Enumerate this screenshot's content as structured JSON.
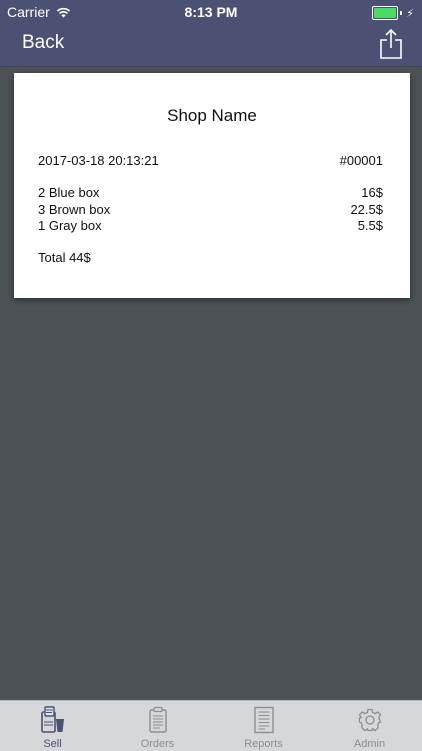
{
  "status": {
    "carrier": "Carrier",
    "time": "8:13 PM"
  },
  "nav": {
    "back_label": "Back",
    "share_icon": "share-icon"
  },
  "receipt": {
    "shop_name": "Shop Name",
    "datetime": "2017-03-18 20:13:21",
    "order_number": "#00001",
    "items": [
      {
        "description": "2 Blue box",
        "price": "16$"
      },
      {
        "description": "3 Brown box",
        "price": "22.5$"
      },
      {
        "description": "1 Gray box",
        "price": "5.5$"
      }
    ],
    "total": "Total 44$"
  },
  "tabbar": {
    "tabs": [
      {
        "label": "Sell",
        "icon": "sell-icon",
        "active": true
      },
      {
        "label": "Orders",
        "icon": "orders-icon",
        "active": false
      },
      {
        "label": "Reports",
        "icon": "reports-icon",
        "active": false
      },
      {
        "label": "Admin",
        "icon": "gear-icon",
        "active": false
      }
    ]
  },
  "colors": {
    "navbar": "#4a5172",
    "background": "#4d5256",
    "active_tab": "#4a5172",
    "inactive_tab": "#8a8f94",
    "battery": "#4cd964"
  }
}
